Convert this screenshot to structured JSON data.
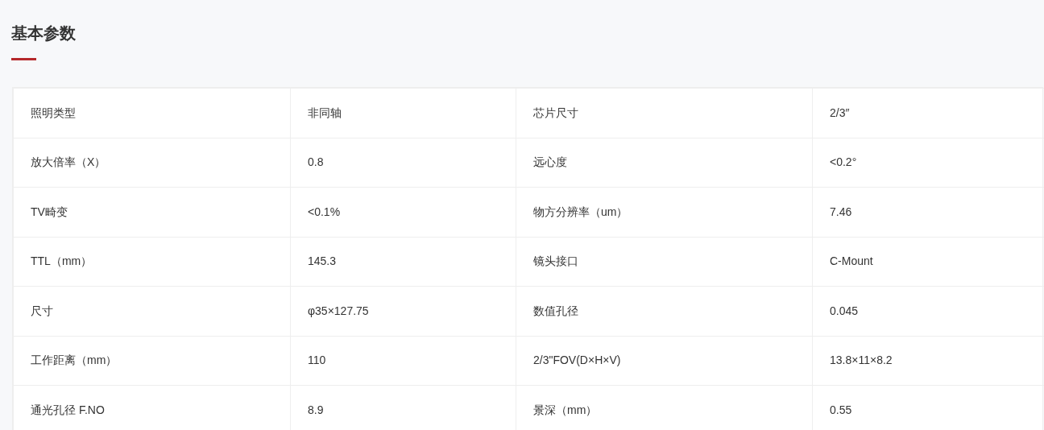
{
  "section": {
    "title": "基本参数"
  },
  "table": {
    "rows": [
      [
        "照明类型",
        "非同轴",
        "芯片尺寸",
        "2/3″"
      ],
      [
        "放大倍率（X）",
        "0.8",
        "远心度",
        "<0.2°"
      ],
      [
        "TV畸变",
        "<0.1%",
        "物方分辨率（um）",
        "7.46"
      ],
      [
        "TTL（mm）",
        "145.3",
        "镜头接口",
        "C-Mount"
      ],
      [
        "尺寸",
        "φ35×127.75",
        "数值孔径",
        "0.045"
      ],
      [
        "工作距离（mm）",
        "110",
        "2/3\"FOV(D×H×V)",
        "13.8×11×8.2"
      ],
      [
        "通光孔径 F.NO",
        "8.9",
        "景深（mm）",
        "0.55"
      ]
    ]
  }
}
